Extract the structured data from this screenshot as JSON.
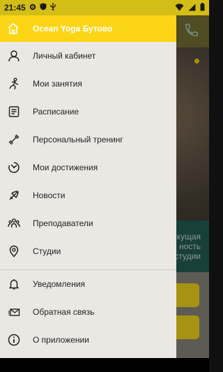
{
  "status_bar": {
    "time": "21:45",
    "left_icons": [
      "gear-icon",
      "shield-icon",
      "usb-icon"
    ],
    "right_icons": [
      "wifi-icon",
      "signal-icon",
      "battery-icon"
    ]
  },
  "background": {
    "teal_text": [
      "кущая",
      "ность",
      "студии"
    ]
  },
  "drawer": {
    "header": {
      "title": "Ocean Yoga Бутово",
      "icon": "home-icon"
    },
    "items": [
      {
        "label": "Личный кабинет",
        "icon": "user-icon"
      },
      {
        "label": "Мои занятия",
        "icon": "running-person-icon"
      },
      {
        "label": "Расписание",
        "icon": "schedule-list-icon"
      },
      {
        "label": "Персональный тренинг",
        "icon": "dumbbell-icon"
      },
      {
        "label": "Мои достижения",
        "icon": "achievement-icon"
      },
      {
        "label": "Новости",
        "icon": "megaphone-icon"
      },
      {
        "label": "Преподаватели",
        "icon": "teachers-group-icon"
      },
      {
        "label": "Студии",
        "icon": "location-pin-icon"
      }
    ],
    "bottom_items": [
      {
        "label": "Уведомления",
        "icon": "bell-icon"
      },
      {
        "label": "Обратная связь",
        "icon": "feedback-envelope-icon"
      },
      {
        "label": "О приложении",
        "icon": "info-icon"
      }
    ]
  },
  "colors": {
    "accent": "#fcd616",
    "drawer_bg": "#ebe8e4",
    "teal": "#1d4b45"
  }
}
